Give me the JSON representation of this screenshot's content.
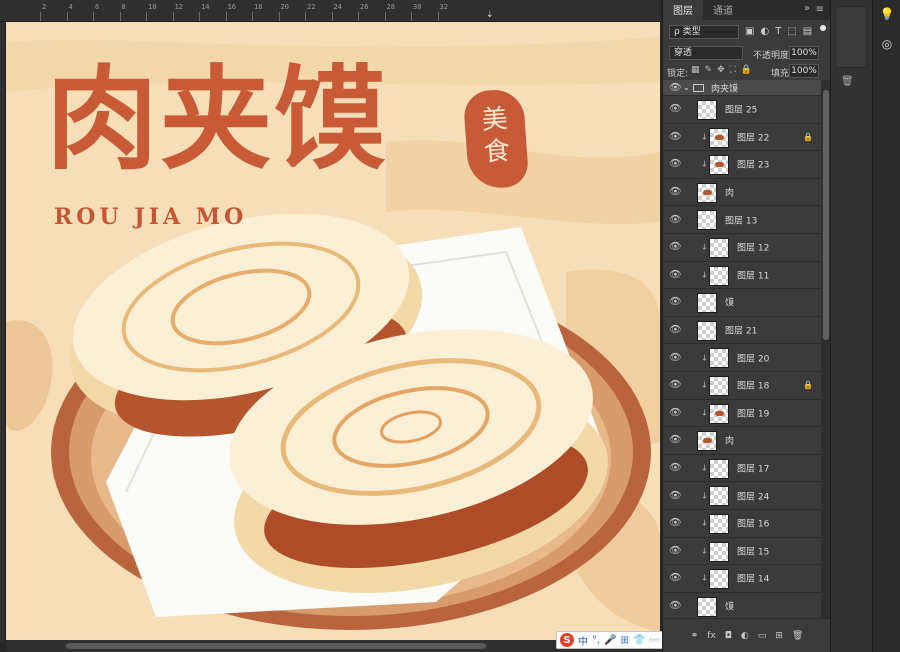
{
  "ruler": {
    "numbers": [
      "2",
      "4",
      "6",
      "8",
      "10",
      "12",
      "14",
      "16",
      "18",
      "20",
      "22",
      "24",
      "26",
      "28",
      "30",
      "32"
    ]
  },
  "artwork": {
    "title_cn": "肉夹馍",
    "seal_line1": "美",
    "seal_line2": "食",
    "title_en": "ROU JIA MO",
    "colors": {
      "background": "#f6dfb8",
      "title": "#c95a36",
      "seal": "#c75b38",
      "plate": "#b9643c",
      "meat": "#b5552e",
      "bun": "#fbefd6"
    }
  },
  "ime": {
    "logo": "S",
    "items": [
      "中",
      "°,",
      "🎤",
      "⊞",
      "👕",
      "⋯"
    ]
  },
  "panel": {
    "tabs": [
      "图层",
      "通道"
    ],
    "filter_kind": "ρ 类型",
    "filter_icons": [
      "▣",
      "◐",
      "T",
      "⬚",
      "▤"
    ],
    "blend_mode": "穿透",
    "opacity_label": "不透明度:",
    "opacity_value": "100%",
    "lock_label": "锁定:",
    "lock_icons": [
      "▦",
      "✎",
      "✥",
      "⛶",
      "🔒"
    ],
    "fill_label": "填充:",
    "fill_value": "100%",
    "group_name": "肉夹馍",
    "layers": [
      {
        "name": "图层 25",
        "clip": false,
        "locked": false,
        "art": false
      },
      {
        "name": "图层 22",
        "clip": true,
        "locked": true,
        "art": true
      },
      {
        "name": "图层 23",
        "clip": true,
        "locked": false,
        "art": true
      },
      {
        "name": "肉",
        "clip": false,
        "locked": false,
        "art": true
      },
      {
        "name": "图层 13",
        "clip": false,
        "locked": false,
        "art": false
      },
      {
        "name": "图层 12",
        "clip": true,
        "locked": false,
        "art": false
      },
      {
        "name": "图层 11",
        "clip": true,
        "locked": false,
        "art": false
      },
      {
        "name": "馍",
        "clip": false,
        "locked": false,
        "art": false
      },
      {
        "name": "图层 21",
        "clip": false,
        "locked": false,
        "art": false
      },
      {
        "name": "图层 20",
        "clip": true,
        "locked": false,
        "art": false
      },
      {
        "name": "图层 18",
        "clip": true,
        "locked": true,
        "art": false
      },
      {
        "name": "图层 19",
        "clip": true,
        "locked": false,
        "art": true
      },
      {
        "name": "肉",
        "clip": false,
        "locked": false,
        "art": true
      },
      {
        "name": "图层 17",
        "clip": true,
        "locked": false,
        "art": false
      },
      {
        "name": "图层 24",
        "clip": true,
        "locked": false,
        "art": false
      },
      {
        "name": "图层 16",
        "clip": true,
        "locked": false,
        "art": false
      },
      {
        "name": "图层 15",
        "clip": true,
        "locked": false,
        "art": false
      },
      {
        "name": "图层 14",
        "clip": true,
        "locked": false,
        "art": false
      },
      {
        "name": "馍",
        "clip": false,
        "locked": false,
        "art": false
      }
    ],
    "footer_icons": [
      "⚭",
      "fx",
      "◘",
      "◐",
      "▭",
      "⊞",
      "🗑"
    ]
  },
  "dock3_icons": [
    "💡",
    "◎"
  ]
}
